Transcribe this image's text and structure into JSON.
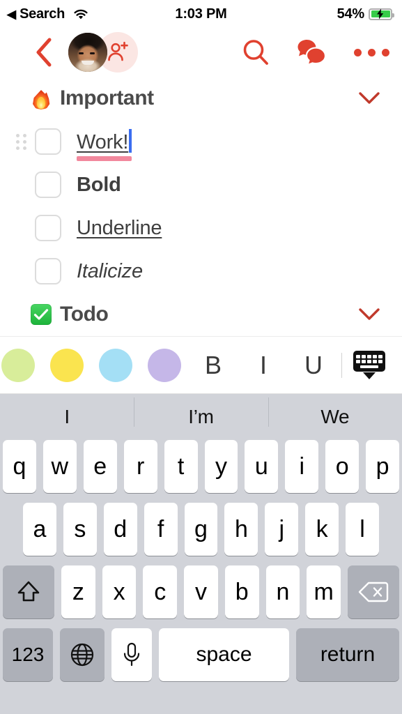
{
  "status_bar": {
    "back_arrow": "◀",
    "back_label": "Search",
    "wifi_icon": "wifi-icon",
    "time": "1:03 PM",
    "battery_percent": "54%",
    "battery_icon": "battery-charging-icon"
  },
  "nav_bar": {
    "back_icon": "chevron-left-icon",
    "avatar_name": "avatar",
    "add_person_icon": "person-add-icon",
    "search_icon": "search-icon",
    "chat_icon": "chat-bubbles-icon",
    "more_icon": "more-dots-icon",
    "accent_color": "#e0412f"
  },
  "sections": [
    {
      "emoji": "fire",
      "title": "Important",
      "chevron_icon": "chevron-down-icon",
      "items": [
        {
          "label": "Work!",
          "style": "editing",
          "checked": false,
          "has_drag_handle": true,
          "highlight_color": "#f2889d",
          "caret": true
        },
        {
          "label": "Bold",
          "style": "bold",
          "checked": false,
          "has_drag_handle": false
        },
        {
          "label": "Underline",
          "style": "underline",
          "checked": false,
          "has_drag_handle": false
        },
        {
          "label": "Italicize",
          "style": "italic",
          "checked": false,
          "has_drag_handle": false
        }
      ]
    },
    {
      "emoji": "check",
      "title": "Todo",
      "chevron_icon": "chevron-down-icon",
      "items": []
    }
  ],
  "format_toolbar": {
    "swatches": [
      {
        "name": "highlight-green",
        "color": "#d8ed9a"
      },
      {
        "name": "highlight-yellow",
        "color": "#fae44f"
      },
      {
        "name": "highlight-blue",
        "color": "#a4dff5"
      },
      {
        "name": "highlight-purple",
        "color": "#c5b7e8"
      }
    ],
    "bold_label": "B",
    "italic_label": "I",
    "underline_label": "U",
    "hide_keyboard_icon": "hide-keyboard-icon"
  },
  "keyboard": {
    "predictions": [
      "I",
      "I’m",
      "We"
    ],
    "row1": [
      "q",
      "w",
      "e",
      "r",
      "t",
      "y",
      "u",
      "i",
      "o",
      "p"
    ],
    "row2": [
      "a",
      "s",
      "d",
      "f",
      "g",
      "h",
      "j",
      "k",
      "l"
    ],
    "row3": [
      "z",
      "x",
      "c",
      "v",
      "b",
      "n",
      "m"
    ],
    "shift_icon": "shift-icon",
    "backspace_icon": "backspace-icon",
    "numbers_label": "123",
    "globe_icon": "globe-icon",
    "mic_icon": "microphone-icon",
    "space_label": "space",
    "return_label": "return"
  }
}
